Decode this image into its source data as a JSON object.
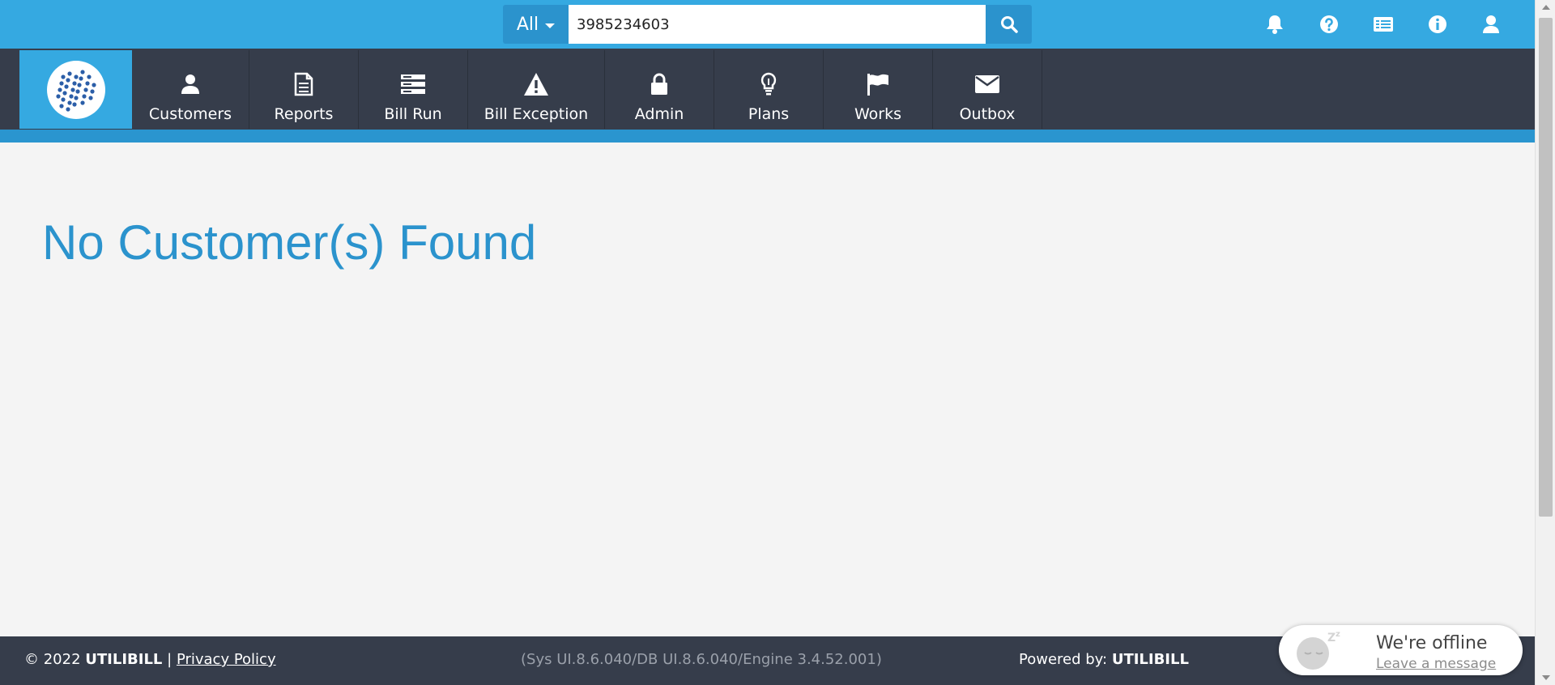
{
  "search": {
    "scope_label": "All",
    "query_value": "3985234603"
  },
  "top_icons": [
    "bell-icon",
    "help-icon",
    "ledger-icon",
    "info-icon",
    "user-icon"
  ],
  "nav": {
    "items": [
      {
        "label": "Customers",
        "icon": "user-icon"
      },
      {
        "label": "Reports",
        "icon": "document-icon"
      },
      {
        "label": "Bill Run",
        "icon": "server-icon"
      },
      {
        "label": "Bill Exception",
        "icon": "warning-icon"
      },
      {
        "label": "Admin",
        "icon": "lock-icon"
      },
      {
        "label": "Plans",
        "icon": "lightbulb-icon"
      },
      {
        "label": "Works",
        "icon": "flag-icon"
      },
      {
        "label": "Outbox",
        "icon": "envelope-icon"
      }
    ]
  },
  "main": {
    "title": "No Customer(s) Found"
  },
  "footer": {
    "copyright_prefix": "© 2022",
    "brand": "UTILIBILL",
    "separator": "|",
    "privacy_link": "Privacy Policy",
    "version": "(Sys UI.8.6.040/DB UI.8.6.040/Engine 3.4.52.001)",
    "powered_prefix": "Powered by:",
    "powered_brand": "UTILIBILL"
  },
  "chat": {
    "status": "We're offline",
    "leave_message": "Leave a message"
  },
  "colors": {
    "topbar": "#35a9e1",
    "accent": "#2b93cd",
    "navbar": "#363d4b",
    "page_bg": "#f4f4f4"
  }
}
